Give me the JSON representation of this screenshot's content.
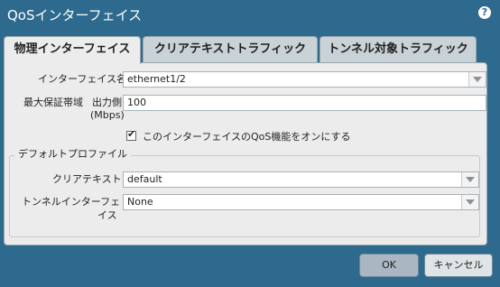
{
  "dialog": {
    "title": "QoSインターフェイス",
    "help_icon": "question-circle-icon",
    "help_glyph": "?"
  },
  "tabs": [
    {
      "label": "物理インターフェイス",
      "active": true
    },
    {
      "label": "クリアテキストトラフィック",
      "active": false
    },
    {
      "label": "トンネル対象トラフィック",
      "active": false
    }
  ],
  "form": {
    "interface_label": "インターフェイス名",
    "interface_value": "ethernet1/2",
    "max_bandwidth_label": "最大保証帯域",
    "egress_label": "出力側",
    "egress_unit": "(Mbps)",
    "egress_value": "100",
    "enable_qos_label": "このインターフェイスのQoS機能をオンにする",
    "enable_qos_checked": true,
    "check_glyph": "✔"
  },
  "default_profile": {
    "legend": "デフォルトプロファイル",
    "clear_text_label": "クリアテキスト",
    "clear_text_value": "default",
    "tunnel_label_line1": "トンネルインターフェ",
    "tunnel_label_line2": "イス",
    "tunnel_value": "None"
  },
  "buttons": {
    "ok": "OK",
    "cancel": "キャンセル"
  }
}
